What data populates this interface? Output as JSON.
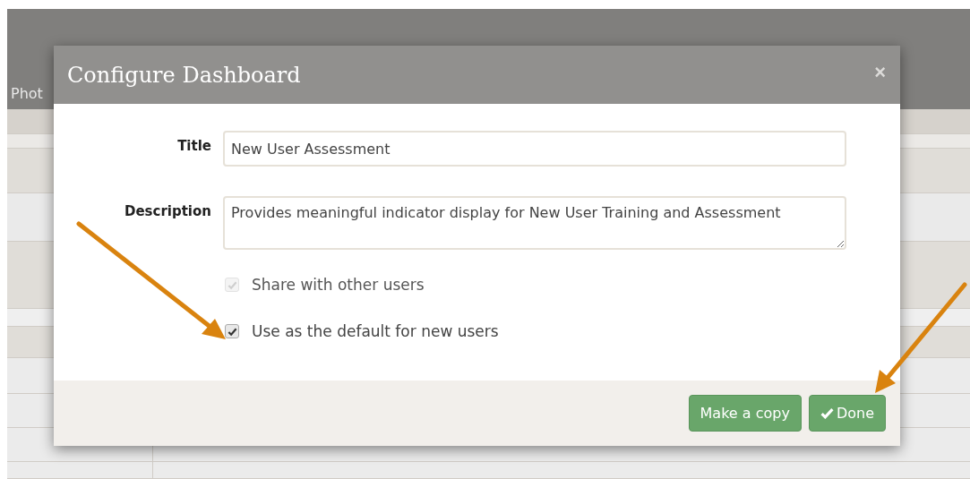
{
  "background": {
    "header_text": "Phot"
  },
  "dialog": {
    "title": "Configure Dashboard",
    "close": "×",
    "fields": [
      {
        "kind": "input",
        "label": "Title",
        "value": "New User Assessment"
      },
      {
        "kind": "textarea",
        "label": "Description",
        "value": "Provides meaningful indicator display for New User Training and Assessment"
      }
    ],
    "options": [
      {
        "label": "Share with other users",
        "checked": true,
        "disabled": true
      },
      {
        "label": "Use as the default for new users",
        "checked": true,
        "disabled": false
      }
    ],
    "buttons": [
      {
        "kind": "plain",
        "label": "Make a copy"
      },
      {
        "kind": "check",
        "label": "Done"
      }
    ]
  }
}
